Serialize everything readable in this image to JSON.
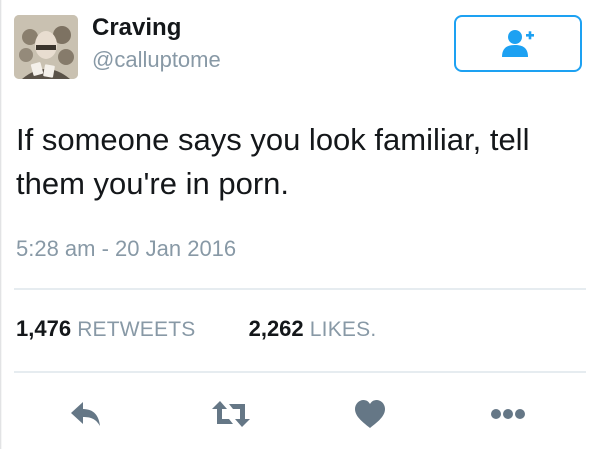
{
  "tweet": {
    "author": {
      "display_name": "Craving",
      "handle": "@calluptome",
      "avatar_icon": "user-avatar"
    },
    "follow_button": {
      "icon": "add-user-icon",
      "accent": "#1da1f2"
    },
    "text_lines": [
      "If someone says you look familiar, tell",
      "them you're in porn."
    ],
    "timestamp": "5:28 am - 20 Jan 2016",
    "stats": {
      "retweets": {
        "count": "1,476",
        "label": "RETWEETS"
      },
      "likes": {
        "count": "2,262",
        "label": "LIKES."
      }
    },
    "actions": [
      {
        "name": "reply",
        "icon": "reply-icon"
      },
      {
        "name": "retweet",
        "icon": "retweet-icon"
      },
      {
        "name": "like",
        "icon": "heart-icon"
      },
      {
        "name": "more",
        "icon": "more-icon"
      }
    ],
    "colors": {
      "text": "#14171a",
      "muted": "#8899a6",
      "accent": "#1da1f2",
      "icon": "#657786",
      "divider": "#e6ecf0"
    }
  }
}
